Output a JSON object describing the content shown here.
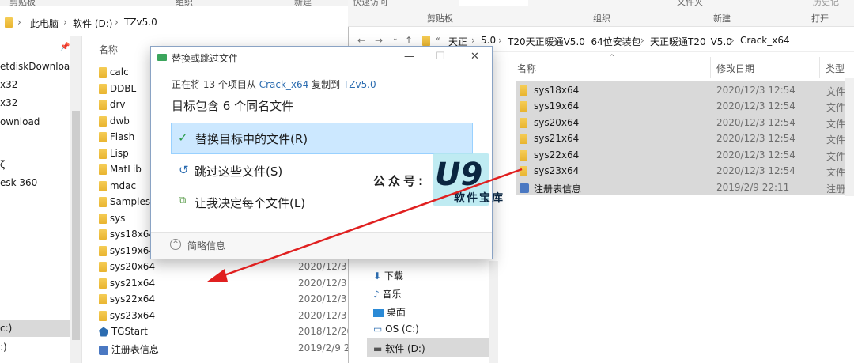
{
  "left": {
    "ribbon": [
      "剪贴板",
      "组织",
      "新建"
    ],
    "breadcrumb": [
      "此电脑",
      "软件 (D:)",
      "TZv5.0"
    ],
    "column_name": "名称",
    "nav_items": [
      "etdiskDownloa",
      "x32",
      "x32",
      "ownload",
      "ζ",
      "esk 360",
      "c:)",
      ":)"
    ],
    "files": [
      {
        "name": "calc",
        "date": ""
      },
      {
        "name": "DDBL",
        "date": ""
      },
      {
        "name": "drv",
        "date": ""
      },
      {
        "name": "dwb",
        "date": ""
      },
      {
        "name": "Flash",
        "date": ""
      },
      {
        "name": "Lisp",
        "date": ""
      },
      {
        "name": "MatLib",
        "date": ""
      },
      {
        "name": "mdac",
        "date": ""
      },
      {
        "name": "Samples",
        "date": ""
      },
      {
        "name": "sys",
        "date": ""
      },
      {
        "name": "sys18x64",
        "date": ""
      },
      {
        "name": "sys19x64",
        "date": ""
      },
      {
        "name": "sys20x64",
        "date": "2020/12/3"
      },
      {
        "name": "sys21x64",
        "date": "2020/12/3"
      },
      {
        "name": "sys22x64",
        "date": "2020/12/3"
      },
      {
        "name": "sys23x64",
        "date": "2020/12/3"
      },
      {
        "name": "TGStart",
        "date": "2018/12/20"
      },
      {
        "name": "注册表信息",
        "date": "2019/2/9 22"
      }
    ]
  },
  "right": {
    "ribbon_top": [
      "快速访问",
      "文件夹",
      "历史记"
    ],
    "ribbon": [
      "剪贴板",
      "组织",
      "新建",
      "打开"
    ],
    "breadcrumb": [
      "天正",
      "5.0",
      "T20天正暖通V5.0  64位安装包",
      "天正暖通T20_V5.0",
      "Crack_x64"
    ],
    "columns": {
      "name": "名称",
      "date": "修改日期",
      "type": "类型"
    },
    "files": [
      {
        "name": "sys18x64",
        "date": "2020/12/3 12:54",
        "type": "文件夹"
      },
      {
        "name": "sys19x64",
        "date": "2020/12/3 12:54",
        "type": "文件夹"
      },
      {
        "name": "sys20x64",
        "date": "2020/12/3 12:54",
        "type": "文件夹"
      },
      {
        "name": "sys21x64",
        "date": "2020/12/3 12:54",
        "type": "文件夹"
      },
      {
        "name": "sys22x64",
        "date": "2020/12/3 12:54",
        "type": "文件夹"
      },
      {
        "name": "sys23x64",
        "date": "2020/12/3 12:54",
        "type": "文件夹"
      },
      {
        "name": "注册表信息",
        "date": "2019/2/9 22:11",
        "type": "注册表"
      }
    ],
    "nav": [
      "下载",
      "音乐",
      "桌面",
      "OS (C:)",
      "软件 (D:)"
    ]
  },
  "dialog": {
    "title": "替换或跳过文件",
    "line1_prefix": "正在将 13 个项目从 ",
    "source": "Crack_x64",
    "line1_mid": " 复制到 ",
    "dest": "TZv5.0",
    "line2": "目标包含 6 个同名文件",
    "opt_replace": "替换目标中的文件(R)",
    "opt_skip": "跳过这些文件(S)",
    "opt_decide": "让我决定每个文件(L)",
    "footer": "简略信息"
  },
  "watermark": {
    "label": "公众号:",
    "logo": "U9",
    "sub": "软件宝库"
  },
  "colors": {
    "selection": "#cce8ff",
    "accent": "#2b6cb0",
    "arrow": "#e02020"
  }
}
